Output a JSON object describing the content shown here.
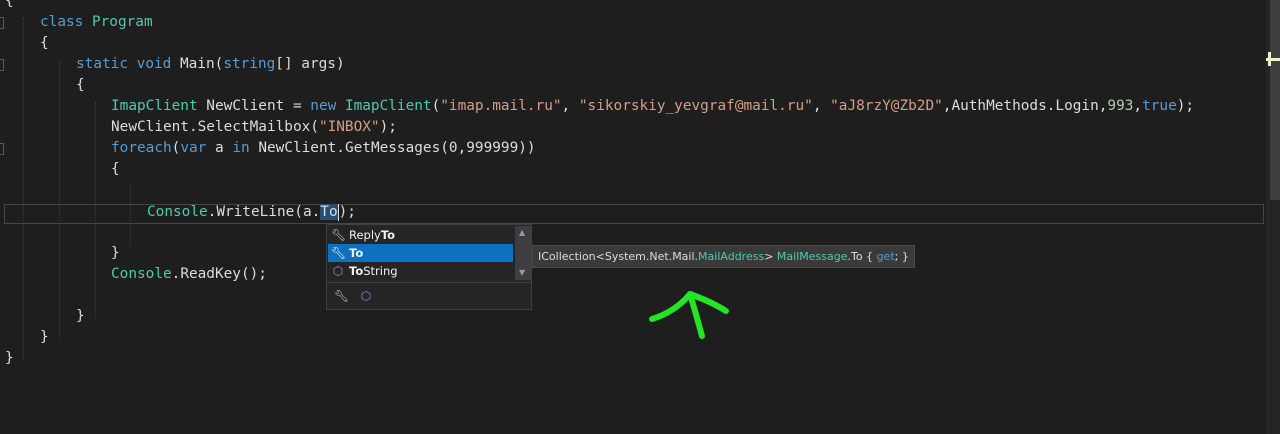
{
  "editor": {
    "lines": [
      {
        "text": "{"
      },
      {
        "parts": [
          [
            "kw",
            "class "
          ],
          [
            "ty",
            "Program"
          ]
        ]
      },
      {
        "text": "{"
      },
      {
        "parts": [
          [
            "kw",
            "static "
          ],
          [
            "kw",
            "void "
          ],
          [
            "pl",
            "Main("
          ],
          [
            "kw",
            "string"
          ],
          [
            "pl",
            "[] args)"
          ]
        ]
      },
      {
        "text": "{"
      },
      {
        "parts": [
          [
            "ty",
            "ImapClient"
          ],
          [
            "pl",
            " NewClient = "
          ],
          [
            "kw",
            "new "
          ],
          [
            "ty",
            "ImapClient"
          ],
          [
            "pl",
            "("
          ],
          [
            "st",
            "\"imap.mail.ru\""
          ],
          [
            "pl",
            ", "
          ],
          [
            "st",
            "\"sikorskiy_yevgraf@mail.ru\""
          ],
          [
            "pl",
            ", "
          ],
          [
            "st",
            "\"aJ8rzY@Zb2D\""
          ],
          [
            "pl",
            ",AuthMethods.Login,"
          ],
          [
            "nm",
            "993"
          ],
          [
            "pl",
            ","
          ],
          [
            "kw",
            "true"
          ],
          [
            "pl",
            ");"
          ]
        ]
      },
      {
        "parts": [
          [
            "pl",
            "NewClient.SelectMailbox("
          ],
          [
            "st",
            "\"INBOX\""
          ],
          [
            "pl",
            ");"
          ]
        ]
      },
      {
        "parts": [
          [
            "kw",
            "foreach"
          ],
          [
            "pl",
            "("
          ],
          [
            "kw",
            "var "
          ],
          [
            "pl",
            "a "
          ],
          [
            "kw",
            "in "
          ],
          [
            "pl",
            "NewClient.GetMessages(0,999999))"
          ]
        ]
      },
      {
        "text": "{"
      },
      {
        "parts": [
          [
            "ty",
            "Console"
          ],
          [
            "pl",
            ".WriteLine(a."
          ],
          [
            "sel",
            "To"
          ],
          [
            "cursor",
            ""
          ],
          [
            "pl",
            ");"
          ]
        ]
      },
      {
        "text": "}"
      },
      {
        "parts": [
          [
            "ty",
            "Console"
          ],
          [
            "pl",
            ".ReadKey();"
          ]
        ]
      },
      {
        "text": "}"
      },
      {
        "text": "}"
      },
      {
        "text": "}"
      }
    ]
  },
  "completion": {
    "items": [
      {
        "prefix": "Reply",
        "match": "To",
        "icon": "wrench-icon",
        "selected": false
      },
      {
        "prefix": "",
        "match": "To",
        "icon": "wrench-icon",
        "selected": true
      },
      {
        "prefix": "",
        "match": "To",
        "suffix": "String",
        "icon": "method-cube-icon",
        "selected": false
      }
    ],
    "filters": [
      "wrench-icon",
      "method-cube-icon"
    ]
  },
  "tooltip": {
    "type_prefix": "ICollection<System.Net.Mail.",
    "type_name": "MailAddress",
    "type_suffix": "> ",
    "owner": "MailMessage",
    "member": ".To { ",
    "accessor": "get",
    "end": "; }"
  },
  "colors": {
    "background": "#1e1e1e",
    "keyword": "#569cd6",
    "type": "#4ec9b0",
    "string": "#d69d85",
    "number": "#b5cea8",
    "selection": "#0e70c0",
    "annotation": "#22e622"
  }
}
